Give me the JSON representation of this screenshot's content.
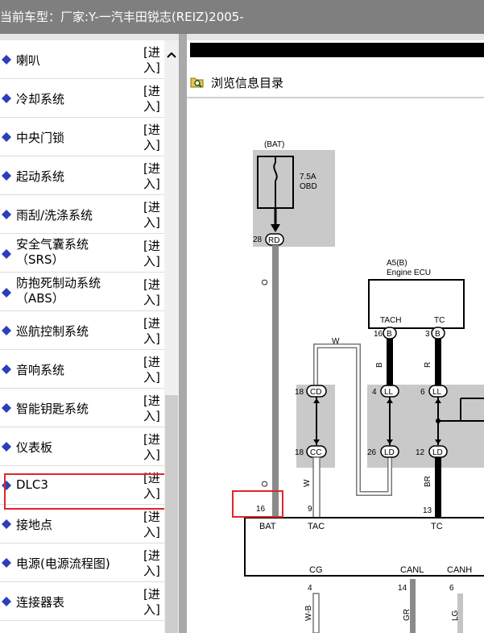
{
  "window": {
    "title": "当前车型：厂家:Y-一汽丰田锐志(REIZ)2005-"
  },
  "menu": {
    "enter_label": "[进入]",
    "items": [
      {
        "label": "喇叭",
        "label2": ""
      },
      {
        "label": "冷却系统",
        "label2": ""
      },
      {
        "label": "中央门锁",
        "label2": ""
      },
      {
        "label": "起动系统",
        "label2": ""
      },
      {
        "label": "雨刮/洗涤系统",
        "label2": ""
      },
      {
        "label": "安全气囊系统",
        "label2": "（SRS）"
      },
      {
        "label": "防抱死制动系统",
        "label2": "（ABS）"
      },
      {
        "label": "巡航控制系统",
        "label2": ""
      },
      {
        "label": "音响系统",
        "label2": ""
      },
      {
        "label": "智能钥匙系统",
        "label2": ""
      },
      {
        "label": "仪表板",
        "label2": ""
      },
      {
        "label": "DLC3",
        "label2": ""
      },
      {
        "label": "接地点",
        "label2": ""
      },
      {
        "label": "电源(电源流程图)",
        "label2": ""
      },
      {
        "label": "连接器表",
        "label2": ""
      }
    ]
  },
  "toolbar": {
    "browse_label": "浏览信息目录"
  },
  "diagram": {
    "bat_top": "(BAT)",
    "fuse_rating": "7.5A",
    "fuse_name": "OBD",
    "pin_28": "28",
    "conn_rd": "RD",
    "wire_o_top": "O",
    "ecu_ref": "A5(B)",
    "ecu_name": "Engine ECU",
    "tach": "TACH",
    "tc": "TC",
    "pin_16_top": "16",
    "pin_3": "3",
    "conn_b1": "B",
    "conn_b2": "B",
    "wire_w_top": "W",
    "wire_b": "B",
    "wire_r": "R",
    "pin_18a": "18",
    "conn_cd": "CD",
    "pin_4": "4",
    "conn_ll1": "LL",
    "pin_6": "6",
    "conn_ll2": "LL",
    "pin_18b": "18",
    "conn_cc": "CC",
    "pin_26": "26",
    "conn_ld1": "LD",
    "pin_12": "12",
    "conn_ld2": "LD",
    "wire_o_bot": "O",
    "wire_w_bot": "W",
    "wire_br": "BR",
    "pin_16_bot": "16",
    "pin_9": "9",
    "pin_13": "13",
    "bat": "BAT",
    "tac": "TAC",
    "tc_bot": "TC",
    "cg": "CG",
    "canl": "CANL",
    "canh": "CANH",
    "pin_4b": "4",
    "pin_14": "14",
    "pin_6b": "6",
    "wire_wb": "W-B",
    "wire_gr": "GR",
    "wire_lg": "LG"
  },
  "colors": {
    "highlight": "#e0242a",
    "diamond": "#2b3fb8",
    "titlebar": "#7f7f80"
  }
}
